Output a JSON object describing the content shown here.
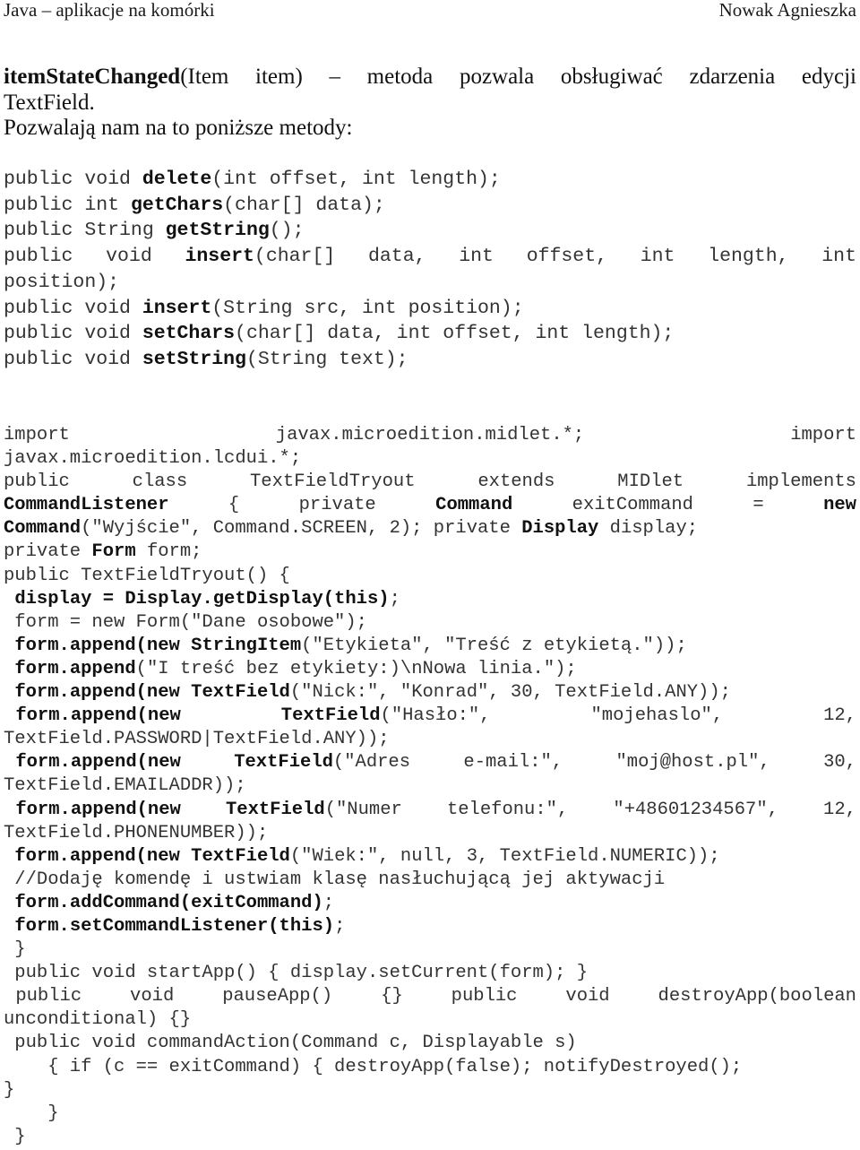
{
  "header": {
    "left": "Java – aplikacje na komórki",
    "right": "Nowak Agnieszka"
  },
  "intro": {
    "method_name": "itemStateChanged",
    "line1_rest": "(Item item) – metoda pozwala obsługiwać zdarzenia edycji",
    "line2": "TextField.",
    "line3": "Pozwalają nam na to poniższe metody:"
  },
  "methods": [
    {
      "just": false,
      "segs": [
        [
          "public void ",
          false
        ],
        [
          "delete",
          true
        ],
        [
          "(int offset, int length);",
          false
        ]
      ]
    },
    {
      "just": false,
      "segs": [
        [
          "public int ",
          false
        ],
        [
          "getChars",
          true
        ],
        [
          "(char[] data);",
          false
        ]
      ]
    },
    {
      "just": false,
      "segs": [
        [
          "public String ",
          false
        ],
        [
          "getString",
          true
        ],
        [
          "();",
          false
        ]
      ]
    },
    {
      "just": true,
      "words": [
        [
          [
            "public",
            false
          ]
        ],
        [
          [
            "void",
            false
          ]
        ],
        [
          [
            "insert",
            true
          ],
          [
            "(char[]",
            false
          ]
        ],
        [
          [
            "data,",
            false
          ]
        ],
        [
          [
            "int",
            false
          ]
        ],
        [
          [
            "offset,",
            false
          ]
        ],
        [
          [
            "int",
            false
          ]
        ],
        [
          [
            "length,",
            false
          ]
        ],
        [
          [
            "int",
            false
          ]
        ]
      ]
    },
    {
      "just": false,
      "segs": [
        [
          "position);",
          false
        ]
      ]
    },
    {
      "just": false,
      "segs": [
        [
          "public void ",
          false
        ],
        [
          "insert",
          true
        ],
        [
          "(String src, int position);",
          false
        ]
      ]
    },
    {
      "just": false,
      "segs": [
        [
          "public void ",
          false
        ],
        [
          "setChars",
          true
        ],
        [
          "(char[] data, int offset, int length);",
          false
        ]
      ]
    },
    {
      "just": false,
      "segs": [
        [
          "public void ",
          false
        ],
        [
          "setString",
          true
        ],
        [
          "(String text);",
          false
        ]
      ]
    }
  ],
  "code": [
    {
      "just": true,
      "words": [
        [
          [
            "import",
            false
          ]
        ],
        [
          [
            "javax.microedition.midlet.*;",
            false
          ]
        ],
        [
          [
            "import",
            false
          ]
        ]
      ]
    },
    {
      "just": false,
      "segs": [
        [
          "javax.microedition.lcdui.*;",
          false
        ]
      ]
    },
    {
      "just": true,
      "words": [
        [
          [
            "public",
            false
          ]
        ],
        [
          [
            "class",
            false
          ]
        ],
        [
          [
            "TextFieldTryout",
            false
          ]
        ],
        [
          [
            "extends",
            false
          ]
        ],
        [
          [
            "MIDlet",
            false
          ]
        ],
        [
          [
            "implements",
            false
          ]
        ]
      ]
    },
    {
      "just": true,
      "words": [
        [
          [
            "CommandListener",
            true
          ]
        ],
        [
          [
            "{",
            false
          ]
        ],
        [
          [
            "private",
            false
          ]
        ],
        [
          [
            "Command",
            true
          ]
        ],
        [
          [
            "exitCommand",
            false
          ]
        ],
        [
          [
            "=",
            false
          ]
        ],
        [
          [
            "new",
            true
          ]
        ]
      ]
    },
    {
      "just": false,
      "segs": [
        [
          "Command",
          true
        ],
        [
          "(\"Wyjście\", Command.SCREEN, 2); private ",
          false
        ],
        [
          "Display",
          true
        ],
        [
          " display;",
          false
        ]
      ]
    },
    {
      "just": false,
      "segs": [
        [
          "private ",
          false
        ],
        [
          "Form",
          true
        ],
        [
          " form;",
          false
        ]
      ]
    },
    {
      "just": false,
      "segs": [
        [
          "public TextFieldTryout() {",
          false
        ]
      ]
    },
    {
      "just": false,
      "segs": [
        [
          " ",
          false
        ],
        [
          "display = Display.getDisplay(this)",
          true
        ],
        [
          ";",
          false
        ]
      ]
    },
    {
      "just": false,
      "segs": [
        [
          " form = new Form(\"Dane osobowe\");",
          false
        ]
      ]
    },
    {
      "just": false,
      "segs": [
        [
          " ",
          false
        ],
        [
          "form.append(new StringItem",
          true
        ],
        [
          "(\"Etykieta\", \"Treść z etykietą.\"));",
          false
        ]
      ]
    },
    {
      "just": false,
      "segs": [
        [
          " ",
          false
        ],
        [
          "form.append",
          true
        ],
        [
          "(\"I treść bez etykiety:)\\nNowa linia.\");",
          false
        ]
      ]
    },
    {
      "just": false,
      "segs": [
        [
          " ",
          false
        ],
        [
          "form.append(new TextField",
          true
        ],
        [
          "(\"Nick:\", \"Konrad\", 30, TextField.ANY));",
          false
        ]
      ]
    },
    {
      "just": true,
      "indent": true,
      "words": [
        [
          [
            "form.append(new",
            true
          ]
        ],
        [
          [
            "TextField",
            true
          ],
          [
            "(\"Hasło:\",",
            false
          ]
        ],
        [
          [
            "\"mojehaslo\",",
            false
          ]
        ],
        [
          [
            "12,",
            false
          ]
        ]
      ]
    },
    {
      "just": false,
      "segs": [
        [
          "TextField.PASSWORD|TextField.ANY));",
          false
        ]
      ]
    },
    {
      "just": true,
      "indent": true,
      "words": [
        [
          [
            "form.append(new",
            true
          ]
        ],
        [
          [
            "TextField",
            true
          ],
          [
            "(\"Adres",
            false
          ]
        ],
        [
          [
            "e-mail:\",",
            false
          ]
        ],
        [
          [
            "\"moj@host.pl\",",
            false
          ]
        ],
        [
          [
            "30,",
            false
          ]
        ]
      ]
    },
    {
      "just": false,
      "segs": [
        [
          "TextField.EMAILADDR));",
          false
        ]
      ]
    },
    {
      "just": true,
      "indent": true,
      "words": [
        [
          [
            "form.append(new",
            true
          ]
        ],
        [
          [
            "TextField",
            true
          ],
          [
            "(\"Numer",
            false
          ]
        ],
        [
          [
            "telefonu:\",",
            false
          ]
        ],
        [
          [
            "\"+48601234567\",",
            false
          ]
        ],
        [
          [
            "12,",
            false
          ]
        ]
      ]
    },
    {
      "just": false,
      "segs": [
        [
          "TextField.PHONENUMBER));",
          false
        ]
      ]
    },
    {
      "just": false,
      "segs": [
        [
          " ",
          false
        ],
        [
          "form.append(new TextField",
          true
        ],
        [
          "(\"Wiek:\", null, 3, TextField.NUMERIC));",
          false
        ]
      ]
    },
    {
      "just": false,
      "segs": [
        [
          " //Dodaję komendę i ustwiam klasę nasłuchującą jej aktywacji",
          false
        ]
      ]
    },
    {
      "just": false,
      "segs": [
        [
          " ",
          false
        ],
        [
          "form.addCommand(exitCommand)",
          true
        ],
        [
          ";",
          false
        ]
      ]
    },
    {
      "just": false,
      "segs": [
        [
          " ",
          false
        ],
        [
          "form.setCommandListener(this)",
          true
        ],
        [
          ";",
          false
        ]
      ]
    },
    {
      "just": false,
      "segs": [
        [
          " }",
          false
        ]
      ]
    },
    {
      "just": false,
      "segs": [
        [
          " public void startApp() { display.setCurrent(form); }",
          false
        ]
      ]
    },
    {
      "just": true,
      "indent": true,
      "words": [
        [
          [
            "public",
            false
          ]
        ],
        [
          [
            "void",
            false
          ]
        ],
        [
          [
            "pauseApp()",
            false
          ]
        ],
        [
          [
            "{}",
            false
          ]
        ],
        [
          [
            "public",
            false
          ]
        ],
        [
          [
            "void",
            false
          ]
        ],
        [
          [
            "destroyApp(boolean",
            false
          ]
        ]
      ]
    },
    {
      "just": false,
      "segs": [
        [
          "unconditional) {}",
          false
        ]
      ]
    },
    {
      "just": false,
      "segs": [
        [
          " public void commandAction(Command c, Displayable s)",
          false
        ]
      ]
    },
    {
      "just": false,
      "segs": [
        [
          "    { if (c == exitCommand) { destroyApp(false); notifyDestroyed();",
          false
        ]
      ]
    },
    {
      "just": false,
      "segs": [
        [
          "}",
          false
        ]
      ]
    },
    {
      "just": false,
      "segs": [
        [
          "    }",
          false
        ]
      ]
    },
    {
      "just": false,
      "segs": [
        [
          " }",
          false
        ]
      ]
    }
  ]
}
